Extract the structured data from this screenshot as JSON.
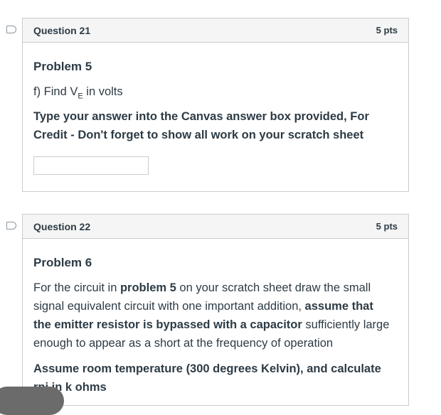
{
  "q21": {
    "title": "Question 21",
    "points": "5 pts",
    "problem": "Problem 5",
    "prompt_prefix": "f) Find V",
    "prompt_sub": "E",
    "prompt_suffix": " in volts",
    "instruction_line1": "Type your answer into the Canvas answer box provided, For",
    "instruction_line2": "Credit - Don't forget to show all work on your scratch sheet",
    "answer_value": ""
  },
  "q22": {
    "title": "Question 22",
    "points": "5 pts",
    "problem": "Problem 6",
    "p1_a": "For the circuit in ",
    "p1_b": "problem 5",
    "p1_c": " on your scratch sheet draw the small",
    "p2_a": "signal equivalent circuit with one important addition, ",
    "p2_b": "assume that",
    "p3_a": "the emitter resistor is bypassed with a capacitor",
    "p3_b": " sufficiently large",
    "p4": "enough to appear as a short at the frequency of operation",
    "assume_line1": "Assume room temperature (300 degrees Kelvin), and calculate",
    "assume_line2": "rpi in k ohms"
  }
}
